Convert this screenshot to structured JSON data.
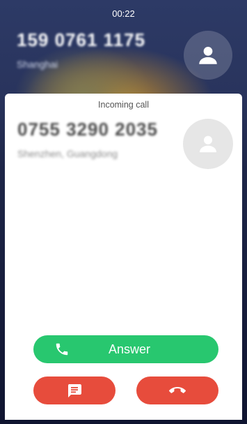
{
  "status_bar": {
    "time": "00:22"
  },
  "active_call": {
    "number": "159 0761 1175",
    "location": "Shanghai",
    "avatar_icon": "person-icon"
  },
  "incoming_call": {
    "header": "Incoming call",
    "number": "0755 3290 2035",
    "location": "Shenzhen, Guangdong",
    "avatar_icon": "person-icon"
  },
  "actions": {
    "answer_label": "Answer",
    "answer_icon": "phone-icon",
    "message_icon": "message-icon",
    "decline_icon": "hang-up-icon"
  },
  "colors": {
    "answer": "#28c76f",
    "decline": "#e74c3c",
    "card_bg": "#ffffff",
    "avatar_placeholder": "#e6e6e6"
  }
}
